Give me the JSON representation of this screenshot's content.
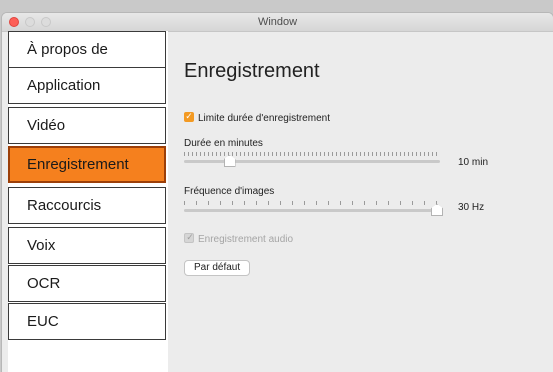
{
  "window": {
    "title": "Window"
  },
  "sidebar": {
    "items": [
      {
        "label": "À propos de"
      },
      {
        "label": "Application"
      },
      {
        "label": "Vidéo"
      },
      {
        "label": "Enregistrement",
        "active": true
      },
      {
        "label": "Raccourcis"
      },
      {
        "label": "Voix"
      },
      {
        "label": "OCR"
      },
      {
        "label": "EUC"
      }
    ]
  },
  "main": {
    "heading": "Enregistrement",
    "limit_checkbox": {
      "label": "Limite durée d'enregistrement",
      "checked": true
    },
    "duration": {
      "label": "Durée en minutes",
      "value_text": "10  min",
      "fraction": 0.17
    },
    "framerate": {
      "label": "Fréquence d'images",
      "value_text": "30  Hz",
      "fraction": 1.0
    },
    "audio_checkbox": {
      "label": "Enregistrement audio",
      "checked": true,
      "disabled": true
    },
    "default_button": "Par défaut"
  },
  "colors": {
    "accent": "#f5801e",
    "checkbox": "#f39a23"
  }
}
